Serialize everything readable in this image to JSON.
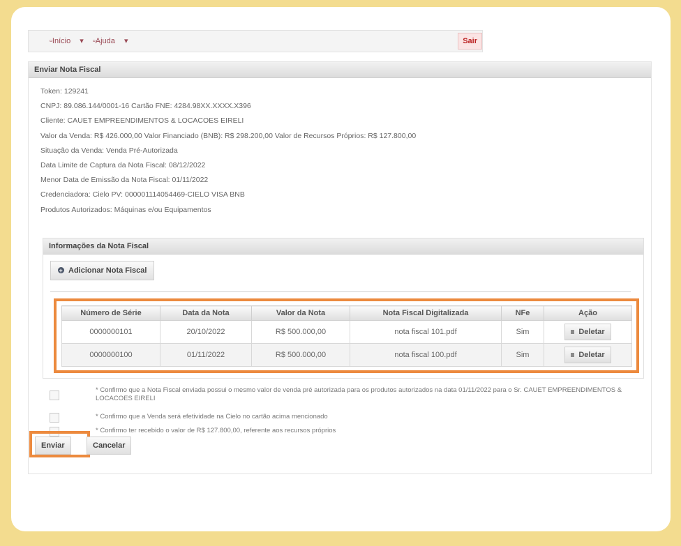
{
  "topbar": {
    "inicio": "Início",
    "ajuda": "Ajuda",
    "sair": "Sair"
  },
  "panel": {
    "title": "Enviar Nota Fiscal"
  },
  "info": [
    "Token:  129241",
    "CNPJ:  89.086.144/0001-16  Cartão FNE:  4284.98XX.XXXX.X396",
    "Cliente:  CAUET EMPREENDIMENTOS & LOCACOES EIRELI",
    "Valor da Venda:  R$ 426.000,00  Valor Financiado (BNB):  R$ 298.200,00  Valor de Recursos Próprios:  R$ 127.800,00",
    "Situação da Venda:  Venda Pré-Autorizada",
    "Data Limite de Captura da Nota Fiscal:  08/12/2022",
    "Menor Data de Emissão da Nota Fiscal:  01/11/2022",
    "Credenciadora:  Cielo  PV:  000001114054469-CIELO VISA BNB",
    "Produtos Autorizados:  Máquinas e/ou Equipamentos"
  ],
  "subpanel": {
    "title": "Informações da Nota Fiscal",
    "add_button": "Adicionar Nota Fiscal"
  },
  "table": {
    "headers": [
      "Número de Série",
      "Data da Nota",
      "Valor da Nota",
      "Nota Fiscal Digitalizada",
      "NFe",
      "Ação"
    ],
    "rows": [
      [
        "0000000101",
        "20/10/2022",
        "R$ 500.000,00",
        "nota fiscal 101.pdf",
        "Sim",
        "Deletar"
      ],
      [
        "0000000100",
        "01/11/2022",
        "R$ 500.000,00",
        "nota fiscal 100.pdf",
        "Sim",
        "Deletar"
      ]
    ]
  },
  "confirmations": [
    "* Confirmo que a Nota Fiscal enviada possui o mesmo valor de venda pré autorizada para os produtos autorizados na data 01/11/2022 para o Sr. CAUET EMPREENDIMENTOS & LOCACOES EIRELI",
    "* Confirmo que a Venda será efetividade na Cielo no cartão acima mencionado",
    "* Confirmo ter recebido o valor de R$ 127.800,00, referente aos recursos próprios"
  ],
  "actions": {
    "enviar": "Enviar",
    "cancelar": "Cancelar"
  },
  "colors": {
    "background": "#f3dc8f",
    "highlight": "#ec8a3e",
    "sair": "#b22222"
  }
}
